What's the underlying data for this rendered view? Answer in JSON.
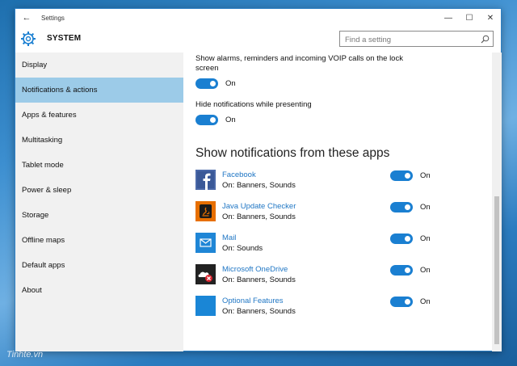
{
  "window": {
    "title": "Settings",
    "back_glyph": "←",
    "controls": {
      "minimize": "—",
      "maximize": "☐",
      "close": "✕"
    }
  },
  "header": {
    "section": "SYSTEM",
    "icon": "gear-icon",
    "search_placeholder": "Find a setting"
  },
  "sidebar": {
    "items": [
      {
        "label": "Display",
        "active": false
      },
      {
        "label": "Notifications & actions",
        "active": true
      },
      {
        "label": "Apps & features",
        "active": false
      },
      {
        "label": "Multitasking",
        "active": false
      },
      {
        "label": "Tablet mode",
        "active": false
      },
      {
        "label": "Power & sleep",
        "active": false
      },
      {
        "label": "Storage",
        "active": false
      },
      {
        "label": "Offline maps",
        "active": false
      },
      {
        "label": "Default apps",
        "active": false
      },
      {
        "label": "About",
        "active": false
      }
    ]
  },
  "main": {
    "lock_screen_text": "Show alarms, reminders and incoming VOIP calls on the lock screen",
    "lock_screen_state": "On",
    "presenting_text": "Hide notifications while presenting",
    "presenting_state": "On",
    "apps_title": "Show notifications from these apps",
    "apps": [
      {
        "name": "Facebook",
        "status": "On: Banners, Sounds",
        "state": "On",
        "icon": "facebook-icon",
        "color": "#3b5998"
      },
      {
        "name": "Java Update Checker",
        "status": "On: Banners, Sounds",
        "state": "On",
        "icon": "java-icon",
        "color": "#e76f00"
      },
      {
        "name": "Mail",
        "status": "On: Sounds",
        "state": "On",
        "icon": "mail-icon",
        "color": "#1f86d6"
      },
      {
        "name": "Microsoft OneDrive",
        "status": "On: Banners, Sounds",
        "state": "On",
        "icon": "onedrive-icon",
        "color": "#222222"
      },
      {
        "name": "Optional Features",
        "status": "On: Banners, Sounds",
        "state": "On",
        "icon": "optional-features-icon",
        "color": "#1a86d6"
      }
    ]
  },
  "watermark": "Tinhte.vn",
  "colors": {
    "accent": "#1a7fd1",
    "nav_active": "#9ccbe8",
    "link": "#1f76c4"
  }
}
